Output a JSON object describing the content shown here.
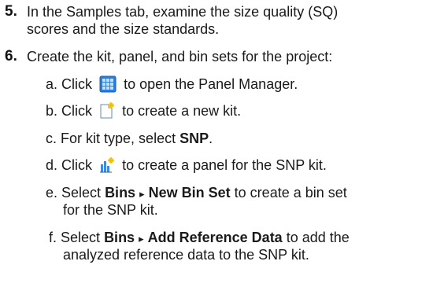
{
  "steps": [
    {
      "number": "5.",
      "lines": [
        "In the Samples tab, examine the size quality (SQ)",
        "scores and the size standards."
      ]
    },
    {
      "number": "6.",
      "text": "Create the kit, panel, and bin sets for the project:",
      "substeps": [
        {
          "letter": "a.",
          "pre": "Click",
          "icon": "panel-manager-grid-icon",
          "post": "to open the Panel Manager."
        },
        {
          "letter": "b.",
          "pre": "Click",
          "icon": "new-kit-document-icon",
          "post": "to create a new kit."
        },
        {
          "letter": "c.",
          "pre": "For kit type, select ",
          "bold": "SNP",
          "post": "."
        },
        {
          "letter": "d.",
          "pre": "Click",
          "icon": "new-panel-icon",
          "post": "to create a panel for the SNP kit."
        },
        {
          "letter": "e.",
          "pre": "Select ",
          "bold1": "Bins",
          "arrow": "▸",
          "bold2": "New Bin Set",
          "post": " to create a bin set",
          "line2": "for the SNP kit."
        },
        {
          "letter": "f.",
          "pre": "Select ",
          "bold1": "Bins",
          "arrow": "▸",
          "bold2": "Add Reference Data",
          "post": " to add the",
          "line2": "analyzed reference data to the SNP kit."
        }
      ]
    }
  ]
}
